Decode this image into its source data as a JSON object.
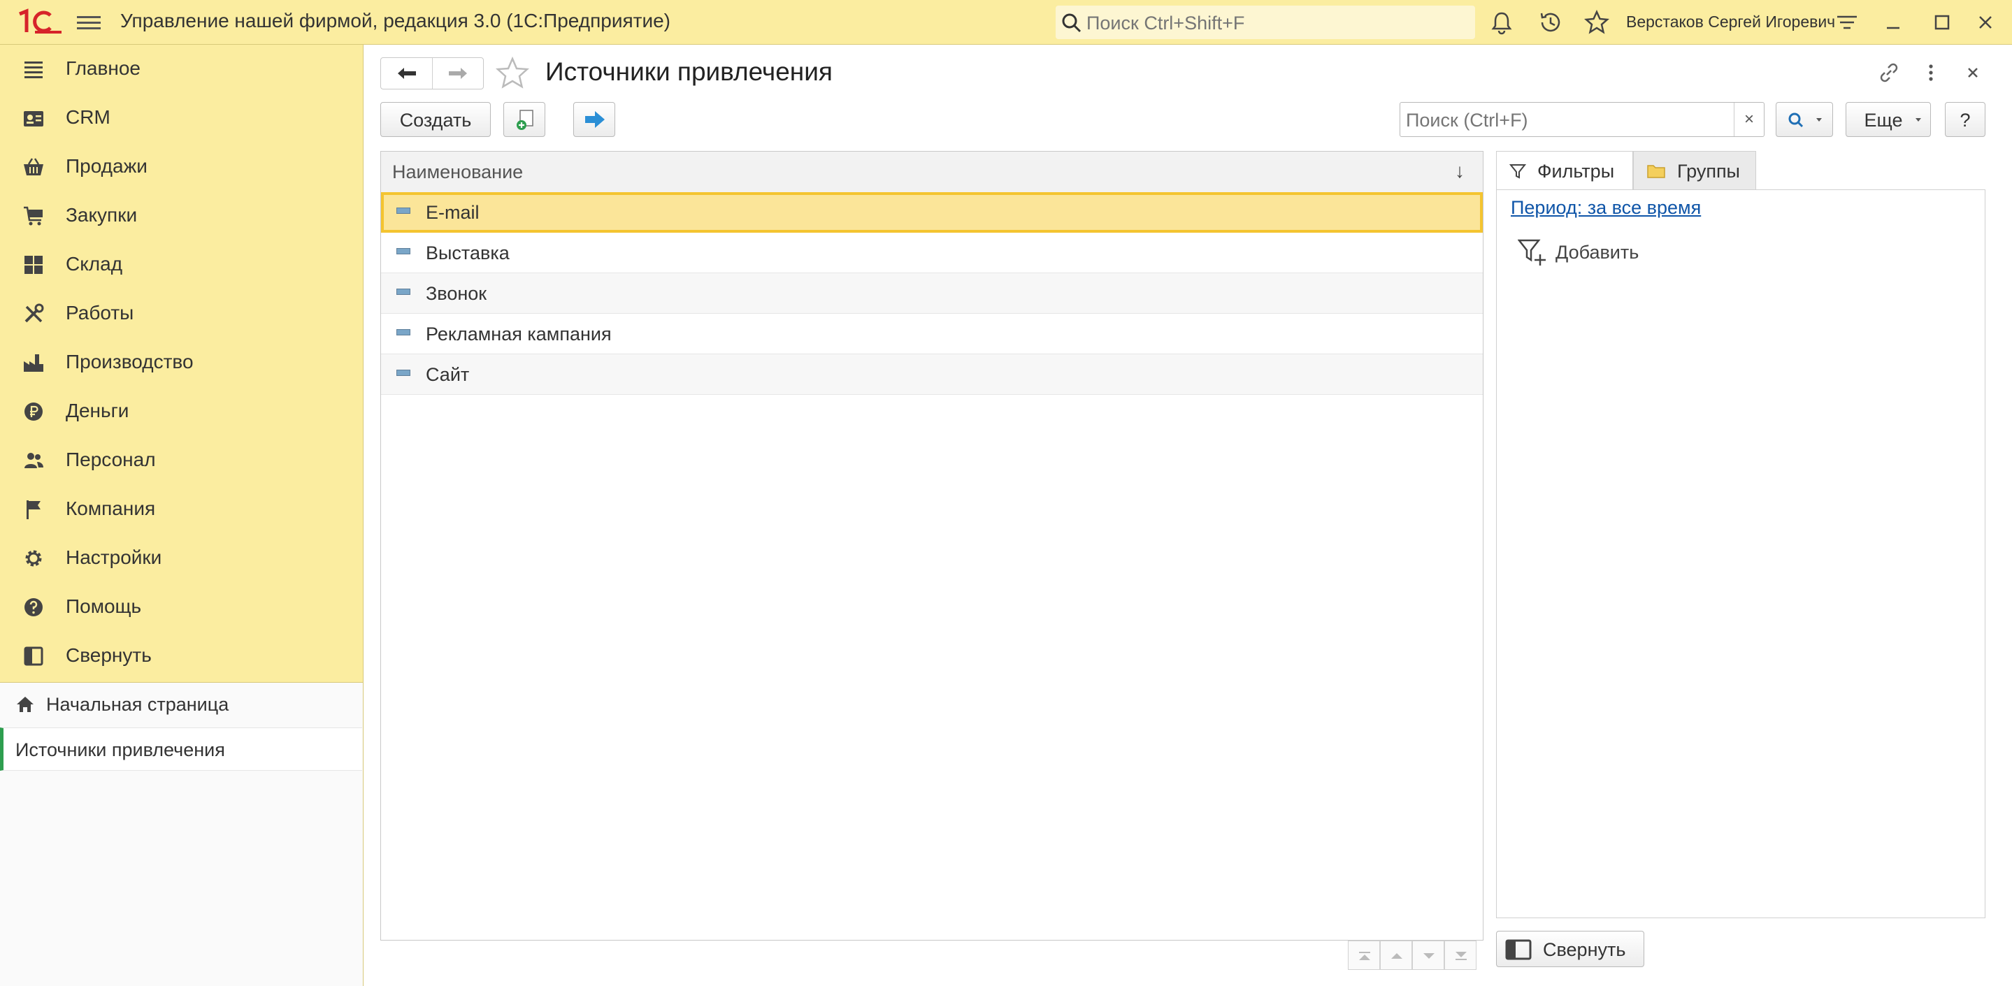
{
  "titlebar": {
    "app_title": "Управление нашей фирмой, редакция 3.0  (1С:Предприятие)",
    "search_placeholder": "Поиск Ctrl+Shift+F",
    "user_name": "Верстаков Сергей Игоревич"
  },
  "sidebar": {
    "items": [
      {
        "label": "Главное",
        "icon": "menu-lines-icon"
      },
      {
        "label": "CRM",
        "icon": "contact-card-icon"
      },
      {
        "label": "Продажи",
        "icon": "basket-icon"
      },
      {
        "label": "Закупки",
        "icon": "cart-icon"
      },
      {
        "label": "Склад",
        "icon": "grid-icon"
      },
      {
        "label": "Работы",
        "icon": "tools-icon"
      },
      {
        "label": "Производство",
        "icon": "factory-icon"
      },
      {
        "label": "Деньги",
        "icon": "ruble-icon"
      },
      {
        "label": "Персонал",
        "icon": "people-icon"
      },
      {
        "label": "Компания",
        "icon": "flag-icon"
      },
      {
        "label": "Настройки",
        "icon": "gear-icon"
      },
      {
        "label": "Помощь",
        "icon": "help-icon"
      },
      {
        "label": "Свернуть",
        "icon": "collapse-panel-icon"
      }
    ]
  },
  "open_windows": {
    "home": "Начальная страница",
    "current": "Источники привлечения"
  },
  "form": {
    "title": "Источники привлечения",
    "create_label": "Создать",
    "search_placeholder": "Поиск (Ctrl+F)",
    "clear_label": "×",
    "more_label": "Еще",
    "help_label": "?",
    "column_header": "Наименование",
    "sort_indicator": "↓",
    "rows": [
      "E-mail",
      "Выставка",
      "Звонок",
      "Рекламная кампания",
      "Сайт"
    ],
    "selected_row": "E-mail"
  },
  "side_panel": {
    "tab_filters": "Фильтры",
    "tab_groups": "Группы",
    "period_link": "Период: за все время",
    "add_label": "Добавить",
    "collapse_label": "Свернуть"
  },
  "colors": {
    "header_yellow": "#fbeda0",
    "selection_fill": "#fbe599",
    "selection_border": "#f4c430",
    "link_blue": "#0f55a8",
    "logo_red": "#d6232a",
    "active_marker_green": "#2e9e4f"
  }
}
